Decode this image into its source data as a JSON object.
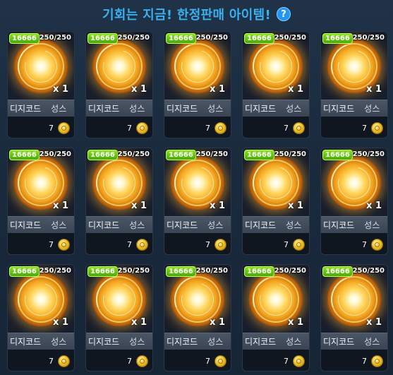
{
  "header": {
    "title": "기회는 지금! 한정판매 아이템!",
    "help_label": "?"
  },
  "icons": {
    "item": "golden-disc-icon",
    "currency": "gold-coin-icon",
    "help": "question-circle-icon"
  },
  "colors": {
    "title": "#3ab0f0",
    "badge": "#6cc815",
    "coin": "#f0c02a"
  },
  "items": [
    {
      "badge": "16666",
      "stock": "250/250",
      "qty": "x 1",
      "name": "디지코드",
      "subname": "성스",
      "price": "7"
    },
    {
      "badge": "16666",
      "stock": "250/250",
      "qty": "x 1",
      "name": "디지코드",
      "subname": "성스",
      "price": "7"
    },
    {
      "badge": "16666",
      "stock": "250/250",
      "qty": "x 1",
      "name": "디지코드",
      "subname": "성스",
      "price": "7"
    },
    {
      "badge": "16666",
      "stock": "250/250",
      "qty": "x 1",
      "name": "디지코드",
      "subname": "성스",
      "price": "7"
    },
    {
      "badge": "16666",
      "stock": "250/250",
      "qty": "x 1",
      "name": "디지코드",
      "subname": "성스",
      "price": "7"
    },
    {
      "badge": "16666",
      "stock": "250/250",
      "qty": "x 1",
      "name": "디지코드",
      "subname": "성스",
      "price": "7"
    },
    {
      "badge": "16666",
      "stock": "250/250",
      "qty": "x 1",
      "name": "디지코드",
      "subname": "성스",
      "price": "7"
    },
    {
      "badge": "16666",
      "stock": "250/250",
      "qty": "x 1",
      "name": "디지코드",
      "subname": "성스",
      "price": "7"
    },
    {
      "badge": "16666",
      "stock": "250/250",
      "qty": "x 1",
      "name": "디지코드",
      "subname": "성스",
      "price": "7"
    },
    {
      "badge": "16666",
      "stock": "250/250",
      "qty": "x 1",
      "name": "디지코드",
      "subname": "성스",
      "price": "7"
    },
    {
      "badge": "16666",
      "stock": "250/250",
      "qty": "x 1",
      "name": "디지코드",
      "subname": "성스",
      "price": "7"
    },
    {
      "badge": "16666",
      "stock": "250/250",
      "qty": "x 1",
      "name": "디지코드",
      "subname": "성스",
      "price": "7"
    },
    {
      "badge": "16666",
      "stock": "250/250",
      "qty": "x 1",
      "name": "디지코드",
      "subname": "성스",
      "price": "7"
    },
    {
      "badge": "16666",
      "stock": "250/250",
      "qty": "x 1",
      "name": "디지코드",
      "subname": "성스",
      "price": "7"
    },
    {
      "badge": "16666",
      "stock": "250/250",
      "qty": "x 1",
      "name": "디지코드",
      "subname": "성스",
      "price": "7"
    }
  ]
}
